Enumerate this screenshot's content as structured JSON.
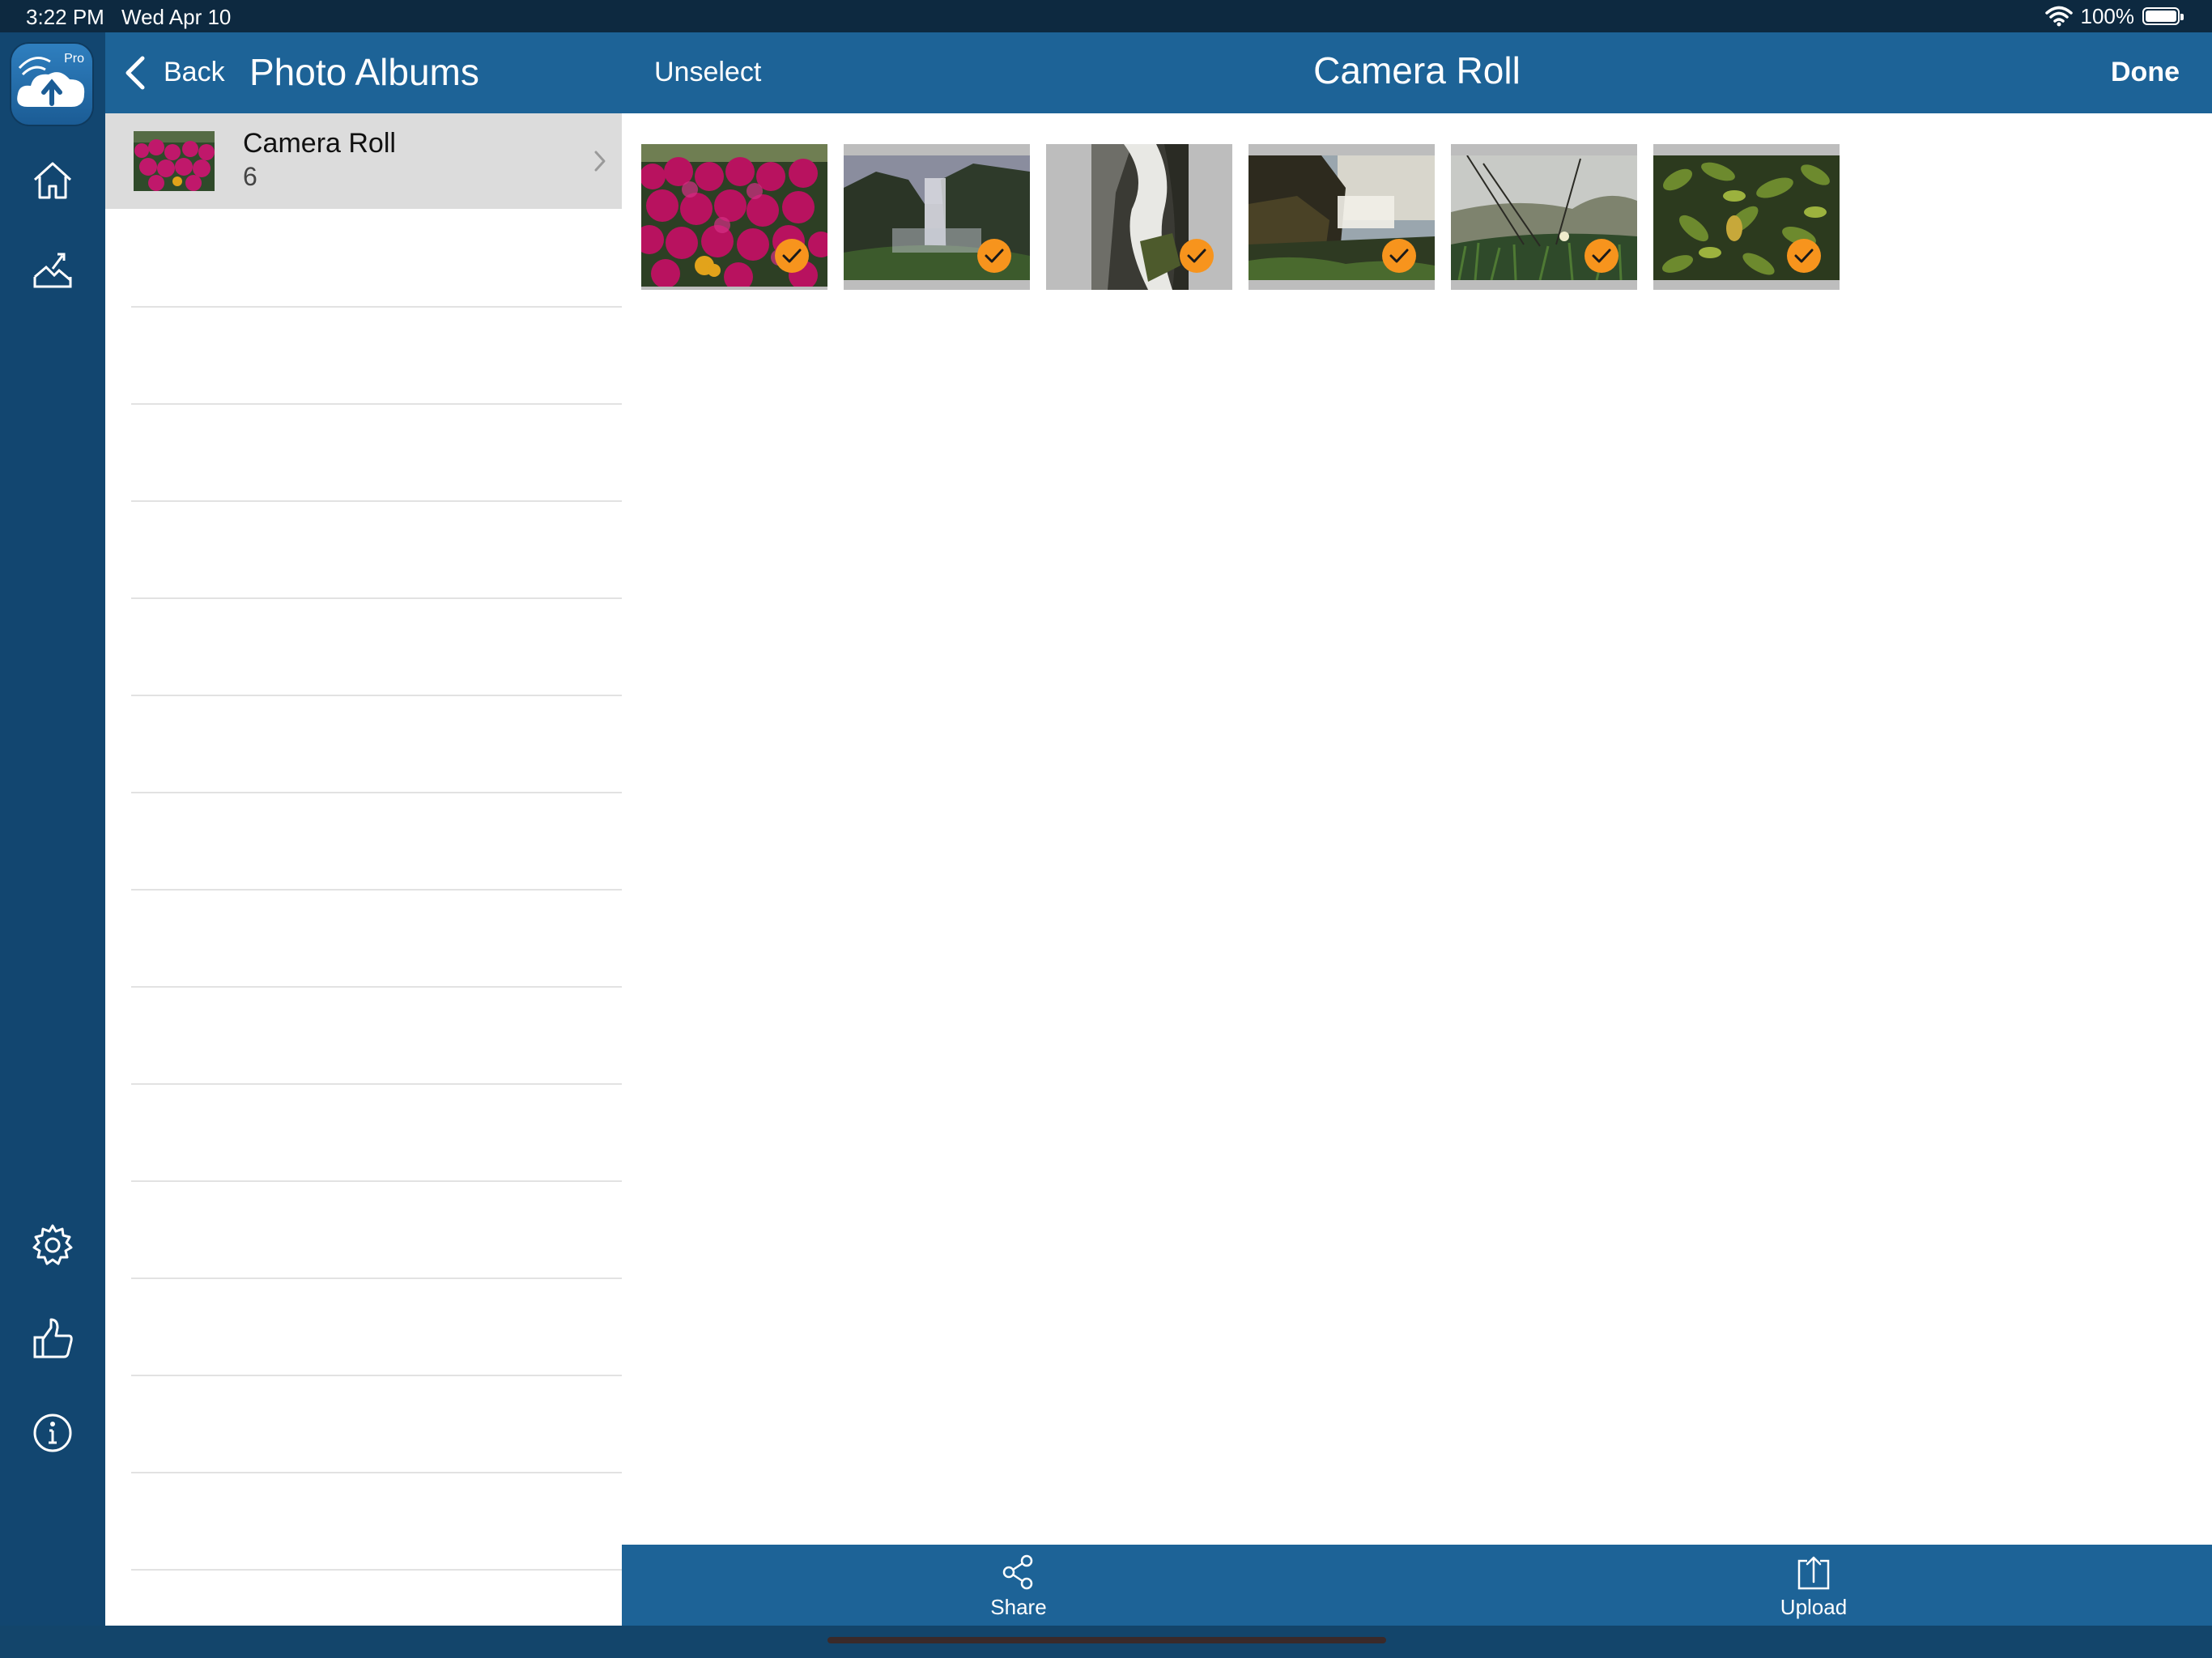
{
  "status": {
    "time": "3:22 PM",
    "date": "Wed Apr 10",
    "battery": "100%",
    "battery_level": 1.0
  },
  "rail": {
    "logo_badge": "Pro",
    "icons": [
      "home-icon",
      "photo-upload-icon",
      "gear-icon",
      "thumbs-up-icon",
      "info-icon"
    ]
  },
  "sidebar": {
    "back_label": "Back",
    "title": "Photo Albums",
    "albums": [
      {
        "name": "Camera Roll",
        "count": "6"
      }
    ]
  },
  "main": {
    "unselect_label": "Unselect",
    "title": "Camera Roll",
    "done_label": "Done",
    "photos": [
      {
        "subject": "pink flowers",
        "selected": true
      },
      {
        "subject": "waterfall",
        "selected": true
      },
      {
        "subject": "waterfall close-up",
        "selected": true
      },
      {
        "subject": "coastal waterfall",
        "selected": true
      },
      {
        "subject": "dune grass",
        "selected": true
      },
      {
        "subject": "green leaves",
        "selected": true
      }
    ]
  },
  "toolbar": {
    "share_label": "Share",
    "upload_label": "Upload"
  },
  "colors": {
    "header_blue": "#1d6397",
    "rail_blue": "#124670",
    "check_orange": "#f7941d"
  }
}
